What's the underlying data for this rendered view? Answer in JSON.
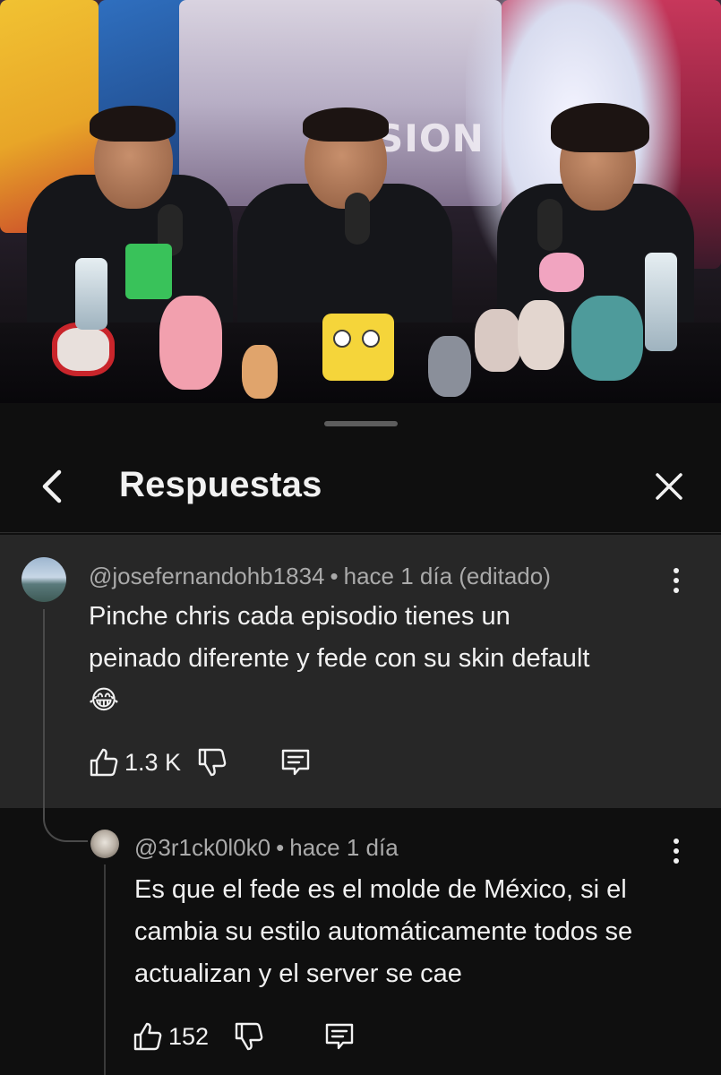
{
  "header": {
    "title": "Respuestas"
  },
  "video": {
    "sign_text": "SION"
  },
  "comment": {
    "author": "@josefernandohb1834",
    "time": "hace 1 día (editado)",
    "text": "Pinche chris cada episodio tienes un peinado diferente y fede con su skin default 😂",
    "likes": "1.3 K"
  },
  "reply": {
    "author": "@3r1ck0l0k0",
    "time": "hace 1 día",
    "text": "Es que el fede es el molde de México, si el cambia su estilo automáticamente todos se actualizan y el server se cae",
    "likes": "152"
  },
  "icons": {
    "back": "chevron-left-icon",
    "close": "close-icon",
    "more": "more-vertical-icon",
    "like": "thumbs-up-icon",
    "dislike": "thumbs-down-icon",
    "reply": "reply-comment-icon"
  },
  "colors": {
    "background": "#0f0f0f",
    "comment_highlight": "#272727",
    "text_primary": "#f1f1f1",
    "text_secondary": "#aaaaaa"
  }
}
